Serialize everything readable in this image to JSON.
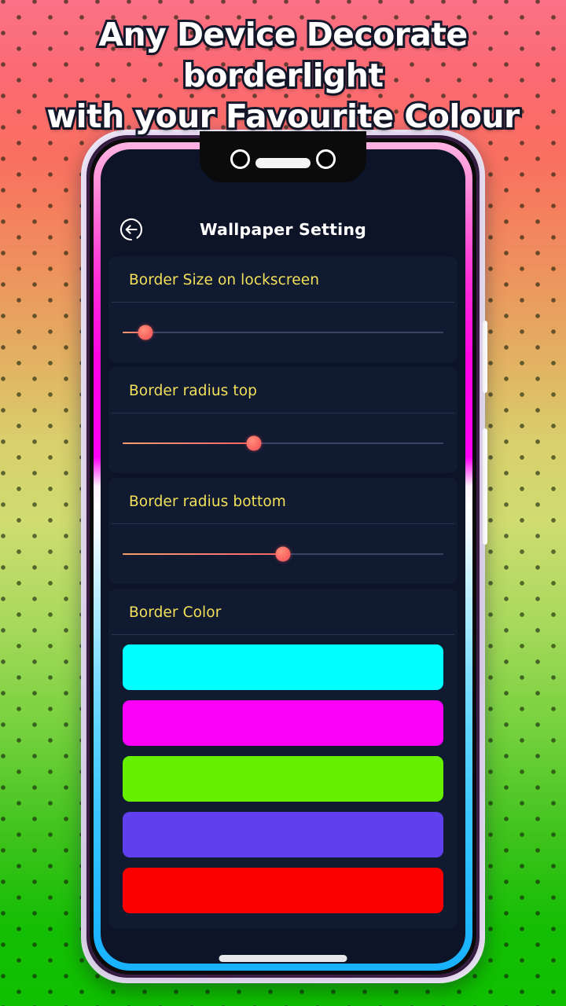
{
  "headline": {
    "line1": "Any Device Decorate borderlight",
    "line2": "with your Favourite Colour",
    "text_color": "#ffffff",
    "outline_color": "#161a2e"
  },
  "background": {
    "gradient_stops": [
      "#fb7186",
      "#f9705f",
      "#e2b262",
      "#cfdc70",
      "#77d13f",
      "#0ec000"
    ],
    "dot_color": "#141e0a"
  },
  "device": {
    "frame_color": "#e7e7ea",
    "bezel_color": "#0b0b0c",
    "notch": {
      "camera_left": "camera-lens",
      "camera_right": "camera-lens",
      "speaker": "earpiece-speaker"
    },
    "borderlight_colors": [
      "#ffb5e0",
      "#f400e0",
      "#ffffff",
      "#8fe0fc",
      "#22b0fa"
    ],
    "side_buttons": [
      "volume-button",
      "power-button"
    ],
    "bottom_bar": "speaker-grille"
  },
  "app": {
    "screen_bg": "#0d1427",
    "back_icon": "back-arrow-circle-icon",
    "title": "Wallpaper Setting",
    "label_color": "#f2e05a",
    "settings": [
      {
        "label": "Border Size on lockscreen",
        "value": 7
      },
      {
        "label": "Border radius top",
        "value": 41
      },
      {
        "label": "Border radius bottom",
        "value": 50
      }
    ],
    "color_section": {
      "label": "Border Color",
      "swatches": [
        {
          "name": "cyan",
          "hex": "#00FFFF"
        },
        {
          "name": "magenta",
          "hex": "#FB00FB"
        },
        {
          "name": "green",
          "hex": "#66F000"
        },
        {
          "name": "purple-blue",
          "hex": "#6040EE"
        },
        {
          "name": "red",
          "hex": "#FB0000"
        }
      ]
    }
  }
}
